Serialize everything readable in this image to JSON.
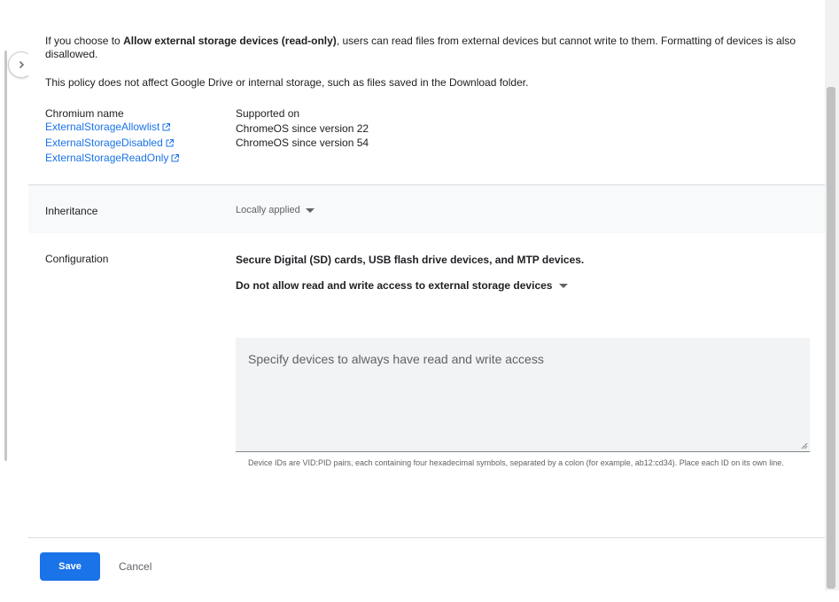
{
  "description": {
    "p1_prefix": "If you choose to ",
    "p1_bold": "Allow external storage devices (read-only)",
    "p1_suffix": ", users can read files from external devices but cannot write to them. Formatting of devices is also disallowed.",
    "p2": "This policy does not affect Google Drive or internal storage, such as files saved in the Download folder."
  },
  "policy_names": {
    "header": "Chromium name",
    "links": [
      {
        "label": "ExternalStorageAllowlist"
      },
      {
        "label": "ExternalStorageDisabled"
      },
      {
        "label": "ExternalStorageReadOnly"
      }
    ]
  },
  "supported_on": {
    "header": "Supported on",
    "items": [
      "ChromeOS since version 22",
      "ChromeOS since version 54"
    ]
  },
  "inheritance": {
    "label": "Inheritance",
    "value": "Locally applied"
  },
  "configuration": {
    "label": "Configuration",
    "title": "Secure Digital (SD) cards, USB flash drive devices, and MTP devices.",
    "selected_option": "Do not allow read and write access to external storage devices",
    "textarea_placeholder": "Specify devices to always have read and write access",
    "helper_text": "Device IDs are VID:PID pairs, each containing four hexadecimal symbols, separated by a colon (for example, ab12:cd34). Place each ID on its own line."
  },
  "footer": {
    "save_label": "Save",
    "cancel_label": "Cancel"
  },
  "colors": {
    "accent": "#1a73e8",
    "text": "#202124",
    "muted": "#5f6368"
  },
  "icons": {
    "expand": "chevron-right-icon",
    "external_link": "open-in-new-icon",
    "dropdown": "caret-down-icon"
  }
}
